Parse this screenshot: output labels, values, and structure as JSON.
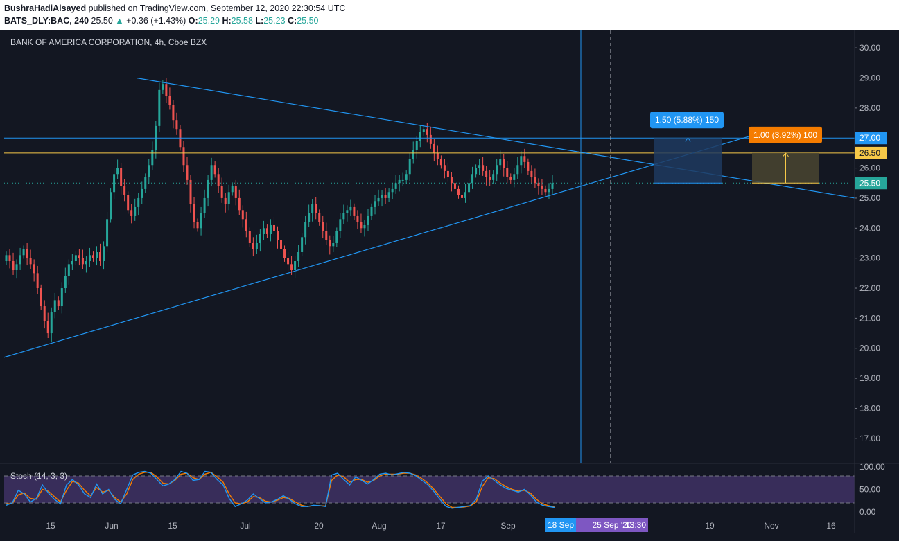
{
  "header": {
    "author": "BushraHadiAlsayed",
    "published_text": " published on TradingView.com, September 12, 2020 22:30:54 UTC",
    "symbol": "BATS_DLY:BAC, 240",
    "last": "25.50",
    "up_arrow": "▲",
    "change": "+0.36 (+1.43%)",
    "o_label": "O:",
    "o_value": "25.29",
    "h_label": "H:",
    "h_value": "25.58",
    "l_label": "L:",
    "l_value": "25.23",
    "c_label": "C:",
    "c_value": "25.50"
  },
  "colors": {
    "background": "#131722",
    "up": "#26a69a",
    "down": "#ef5350",
    "trendline": "#2196f3",
    "horizontal_yellow": "#f7c948",
    "stoch_k": "#2196f3",
    "stoch_d": "#f57c00",
    "stoch_band": "#7e57c2"
  },
  "chart_data": [
    {
      "type": "candlestick",
      "title": "BANK OF AMERICA CORPORATION, 4h, Cboe BZX",
      "ylim": [
        16.5,
        30.5
      ],
      "y_ticks": [
        "30.00",
        "29.00",
        "28.00",
        "27.00",
        "26.00",
        "25.00",
        "24.00",
        "23.00",
        "22.00",
        "21.00",
        "20.00",
        "19.00",
        "18.00",
        "17.00"
      ],
      "x_ticks": [
        "15",
        "Jun",
        "15",
        "Jul",
        "20",
        "Aug",
        "17",
        "Sep",
        "19",
        "Nov",
        "16"
      ],
      "price_labels": [
        {
          "value": 27.0,
          "text": "27.00",
          "color": "#2196f3"
        },
        {
          "value": 26.5,
          "text": "26.50",
          "color": "#f7c948"
        },
        {
          "value": 25.5,
          "text": "25.50",
          "color": "#26a69a"
        }
      ],
      "horizontal_lines": [
        {
          "value": 27.0,
          "color": "#2196f3"
        },
        {
          "value": 26.5,
          "color": "#f7c948"
        },
        {
          "value": 25.5,
          "color": "#26a69a",
          "style": "dotted"
        }
      ],
      "projections": [
        {
          "label": "1.50 (5.88%) 150",
          "from": 25.5,
          "to": 27.0,
          "color": "#2196f3"
        },
        {
          "label": "1.00 (3.92%) 100",
          "from": 25.5,
          "to": 26.5,
          "color": "#f57c00"
        }
      ],
      "series": [
        {
          "name": "BAC",
          "values": [
            23.1,
            22.9,
            22.6,
            22.8,
            23.1,
            23.3,
            23.0,
            22.8,
            22.5,
            22.0,
            21.4,
            20.9,
            20.5,
            21.2,
            21.6,
            21.4,
            22.0,
            22.4,
            22.8,
            22.9,
            23.1,
            23.0,
            22.8,
            22.9,
            23.1,
            23.0,
            23.2,
            22.9,
            23.4,
            24.3,
            25.2,
            25.8,
            26.0,
            25.4,
            25.1,
            24.6,
            24.4,
            24.7,
            25.0,
            25.3,
            25.7,
            26.1,
            26.6,
            27.4,
            28.6,
            28.8,
            28.4,
            28.1,
            27.6,
            27.3,
            26.7,
            26.1,
            25.6,
            24.8,
            24.2,
            24.0,
            24.5,
            25.0,
            25.6,
            26.1,
            25.8,
            25.4,
            25.0,
            24.8,
            25.2,
            25.4,
            25.0,
            24.6,
            24.3,
            23.9,
            23.5,
            23.3,
            23.5,
            23.8,
            24.0,
            23.8,
            24.1,
            23.9,
            23.6,
            23.3,
            23.0,
            22.8,
            22.6,
            22.9,
            23.2,
            23.7,
            24.2,
            24.5,
            24.8,
            24.5,
            24.2,
            23.9,
            23.6,
            23.4,
            23.5,
            23.9,
            24.3,
            24.5,
            24.6,
            24.7,
            24.4,
            24.2,
            24.0,
            24.1,
            24.4,
            24.7,
            24.9,
            25.0,
            25.1,
            25.0,
            25.2,
            25.3,
            25.5,
            25.6,
            25.6,
            25.8,
            26.3,
            26.6,
            26.9,
            27.2,
            27.3,
            27.1,
            26.8,
            26.5,
            26.3,
            26.1,
            25.9,
            25.7,
            25.5,
            25.3,
            25.1,
            25.0,
            25.2,
            25.5,
            25.8,
            26.0,
            26.1,
            25.9,
            25.7,
            25.6,
            25.8,
            26.1,
            26.3,
            26.0,
            25.7,
            25.6,
            25.8,
            26.1,
            26.4,
            26.2,
            25.9,
            25.7,
            25.5,
            25.4,
            25.3,
            25.2,
            25.3,
            25.5
          ]
        }
      ],
      "trendlines": "descending resistance from Jun high, ascending support from May low"
    },
    {
      "type": "line",
      "title": "Stoch (14, 3, 3)",
      "ylim": [
        0,
        100
      ],
      "y_ticks": [
        "100.00",
        "50.00",
        "0.00"
      ],
      "band": [
        20,
        80
      ],
      "series": [
        {
          "name": "K",
          "values": [
            15,
            20,
            48,
            40,
            22,
            30,
            60,
            42,
            28,
            18,
            60,
            72,
            60,
            40,
            32,
            62,
            40,
            50,
            28,
            18,
            50,
            82,
            88,
            90,
            86,
            72,
            58,
            62,
            72,
            90,
            86,
            70,
            72,
            90,
            88,
            72,
            60,
            30,
            12,
            18,
            26,
            40,
            30,
            20,
            22,
            28,
            36,
            28,
            18,
            12,
            12,
            15,
            14,
            12,
            82,
            86,
            72,
            60,
            78,
            70,
            62,
            72,
            84,
            86,
            82,
            85,
            88,
            86,
            80,
            70,
            60,
            45,
            28,
            12,
            8,
            10,
            12,
            14,
            28,
            68,
            80,
            70,
            60,
            52,
            48,
            44,
            50,
            38,
            22,
            15,
            12,
            10
          ]
        },
        {
          "name": "D",
          "values": [
            18,
            19,
            38,
            42,
            30,
            28,
            50,
            46,
            34,
            22,
            48,
            68,
            64,
            48,
            36,
            54,
            44,
            48,
            32,
            22,
            40,
            72,
            84,
            88,
            88,
            78,
            64,
            62,
            70,
            84,
            86,
            76,
            72,
            84,
            88,
            78,
            66,
            40,
            20,
            18,
            22,
            34,
            32,
            24,
            22,
            26,
            32,
            30,
            22,
            15,
            12,
            14,
            14,
            13,
            70,
            82,
            78,
            66,
            72,
            72,
            66,
            70,
            80,
            84,
            84,
            84,
            86,
            86,
            82,
            74,
            64,
            50,
            34,
            18,
            10,
            10,
            11,
            13,
            22,
            56,
            76,
            74,
            64,
            56,
            50,
            46,
            48,
            42,
            28,
            18,
            14,
            11
          ]
        }
      ]
    }
  ],
  "time_labels": {
    "range_start": "18 Sep",
    "range_end": "25 Sep '20",
    "time": "13:30"
  }
}
